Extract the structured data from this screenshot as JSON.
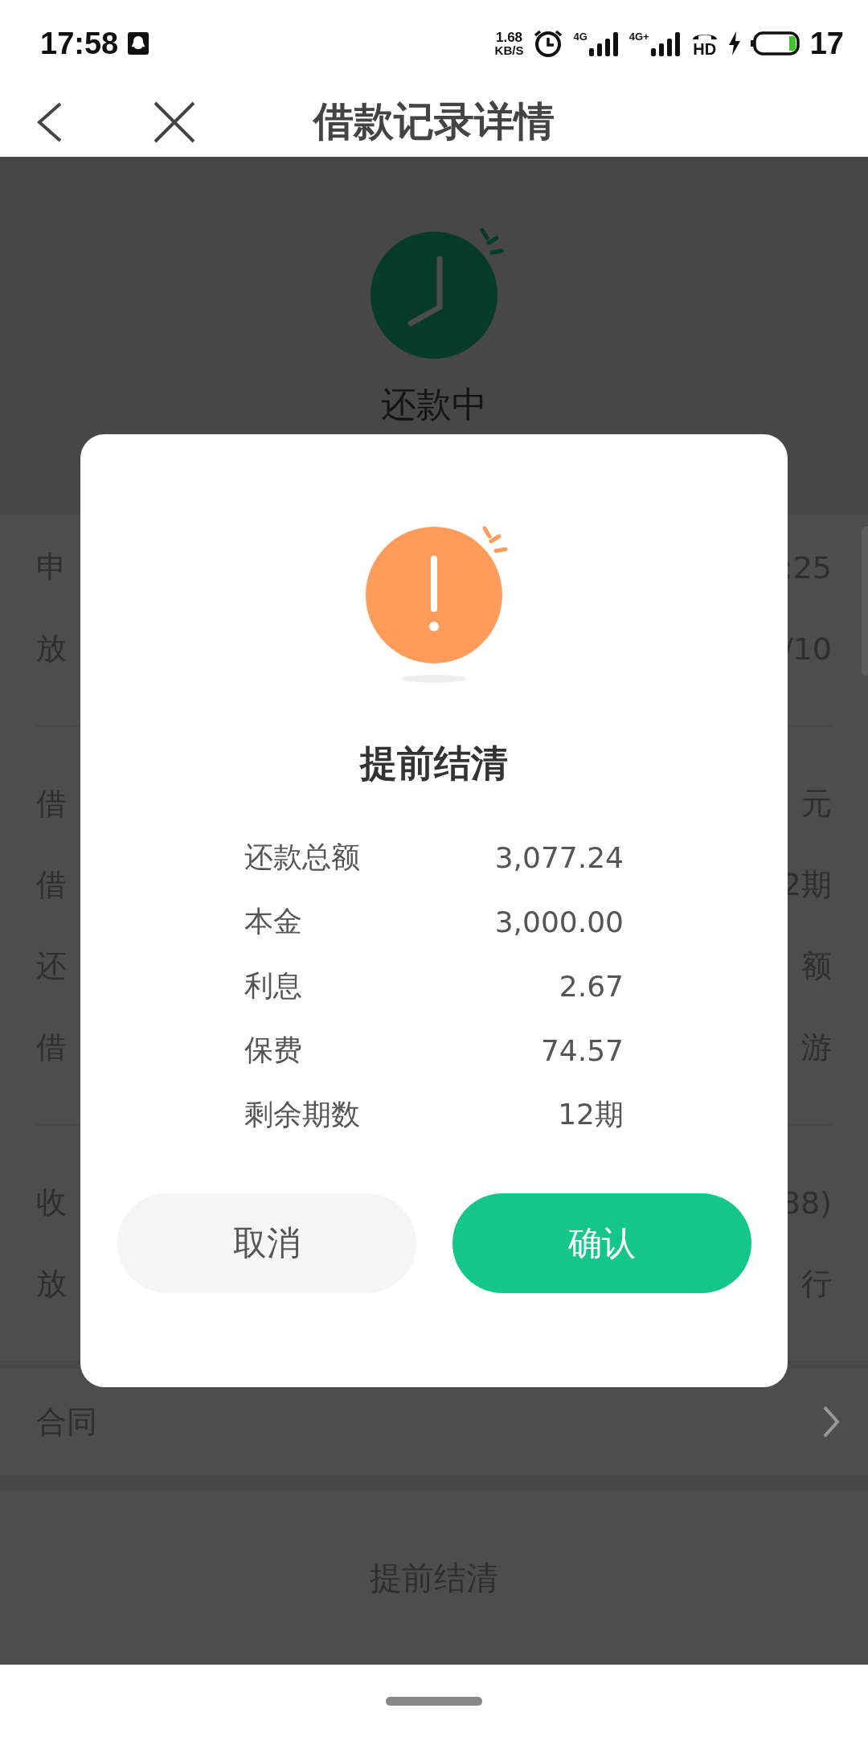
{
  "status_bar": {
    "time": "17:58",
    "speed_value": "1.68",
    "speed_unit": "KB/S",
    "signal_1": "4G",
    "signal_2": "4G+",
    "call_label": "HD",
    "battery": "17"
  },
  "header": {
    "title": "借款记录详情"
  },
  "loan_status": {
    "label": "还款中"
  },
  "detail_groups": [
    {
      "rows": [
        {
          "label": "申",
          "value": ":25"
        },
        {
          "label": "放",
          "value": "/10"
        }
      ]
    },
    {
      "rows": [
        {
          "label": "借",
          "value": "元"
        },
        {
          "label": "借",
          "value": "2期"
        },
        {
          "label": "还",
          "value": "额"
        },
        {
          "label": "借",
          "value": "游"
        }
      ]
    },
    {
      "rows": [
        {
          "label": "收",
          "value": "88)"
        },
        {
          "label": "放",
          "value": "行"
        }
      ]
    }
  ],
  "contract": {
    "label": "合同"
  },
  "bottom_button": {
    "label": "提前结清"
  },
  "dialog": {
    "title": "提前结清",
    "rows": [
      {
        "label": "还款总额",
        "value": "3,077.24"
      },
      {
        "label": "本金",
        "value": "3,000.00"
      },
      {
        "label": "利息",
        "value": "2.67"
      },
      {
        "label": "保费",
        "value": "74.57"
      },
      {
        "label": "剩余期数",
        "value": "12期"
      }
    ],
    "cancel": "取消",
    "confirm": "确认"
  }
}
